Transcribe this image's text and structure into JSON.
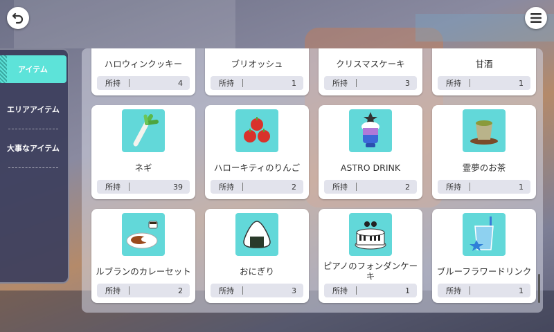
{
  "nav": {
    "back_icon": "back-arrow-icon",
    "menu_icon": "hamburger-menu-icon"
  },
  "sidebar": {
    "tabs": [
      {
        "label": "アイテム",
        "active": true
      },
      {
        "label": "エリアアイテム",
        "active": false
      },
      {
        "label": "大事なアイテム",
        "active": false
      }
    ]
  },
  "items": {
    "qty_label": "所持",
    "list": [
      {
        "name": "ハロウィンクッキー",
        "qty": "4",
        "icon": "halloween-cookie-icon"
      },
      {
        "name": "ブリオッシュ",
        "qty": "1",
        "icon": "brioche-icon"
      },
      {
        "name": "クリスマスケーキ",
        "qty": "3",
        "icon": "christmas-cake-icon"
      },
      {
        "name": "甘酒",
        "qty": "1",
        "icon": "amazake-icon"
      },
      {
        "name": "ネギ",
        "qty": "39",
        "icon": "green-onion-icon"
      },
      {
        "name": "ハローキティのりんご",
        "qty": "2",
        "icon": "apples-icon"
      },
      {
        "name": "ASTRO DRINK",
        "qty": "2",
        "icon": "astro-drink-icon"
      },
      {
        "name": "霊夢のお茶",
        "qty": "1",
        "icon": "green-tea-icon"
      },
      {
        "name": "ルブランのカレーセット",
        "qty": "2",
        "icon": "curry-set-icon"
      },
      {
        "name": "おにぎり",
        "qty": "3",
        "icon": "onigiri-icon"
      },
      {
        "name": "ピアノのフォンダンケーキ",
        "qty": "1",
        "icon": "piano-fondant-cake-icon"
      },
      {
        "name": "ブルーフラワードリンク",
        "qty": "1",
        "icon": "blue-flower-drink-icon"
      }
    ]
  }
}
